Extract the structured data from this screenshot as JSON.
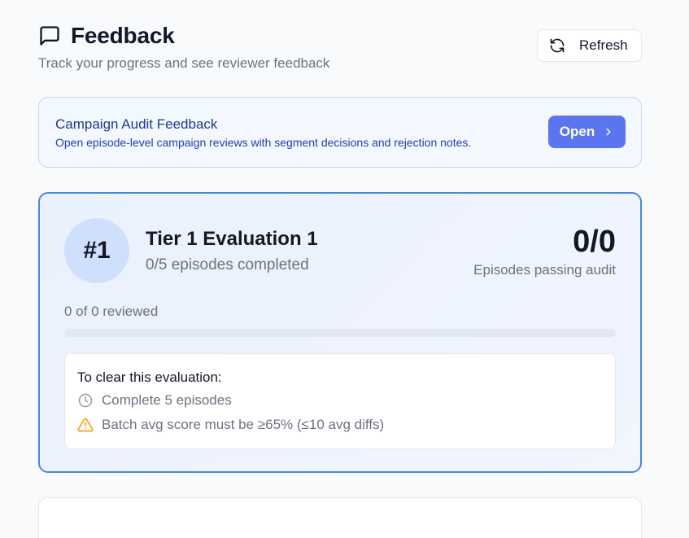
{
  "header": {
    "title": "Feedback",
    "subtitle": "Track your progress and see reviewer feedback",
    "title_icon": "message-square-icon",
    "refresh_label": "Refresh",
    "refresh_icon": "refresh-icon"
  },
  "banner": {
    "title": "Campaign Audit Feedback",
    "description": "Open episode-level campaign reviews with segment decisions and rejection notes.",
    "open_label": "Open",
    "open_icon": "chevron-right-icon"
  },
  "evaluation": {
    "rank": "#1",
    "title": "Tier 1 Evaluation 1",
    "episodes_completed": "0/5 episodes completed",
    "score": "0/0",
    "score_label": "Episodes passing audit",
    "reviewed_text": "0 of 0 reviewed",
    "review_progress_percent": 0,
    "requirements": {
      "title": "To clear this evaluation:",
      "items": [
        {
          "icon": "clock-icon",
          "text": "Complete 5 episodes"
        },
        {
          "icon": "warning-triangle-icon",
          "text": "Batch avg score must be ≥65% (≤10 avg diffs)"
        }
      ]
    }
  },
  "colors": {
    "accent": "#4a87e0",
    "button_primary": "#5b75ee",
    "warning": "#f59e0b"
  }
}
